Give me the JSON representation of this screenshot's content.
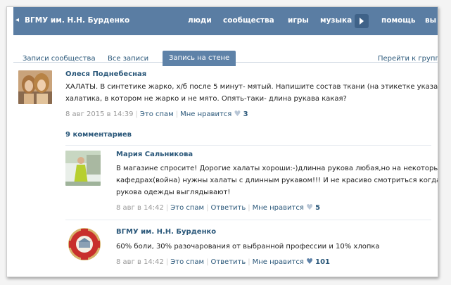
{
  "topbar": {
    "back_glyph": "◂",
    "title": "ВГМУ им. Н.Н. Бурденко",
    "nav": [
      "люди",
      "сообщества",
      "игры",
      "музыка",
      "помощь",
      "вы"
    ]
  },
  "tabs": {
    "items": [
      "Записи сообщества",
      "Все записи",
      "Запись на стене"
    ],
    "active_index": 2,
    "right_link": "Перейти к групп"
  },
  "post": {
    "author": "Олеся Поднебесная",
    "text_line1": "ХАЛАТЫ. В синтетике жарко, х/б после 5 минут- мятый. Напишите состав ткани (на этикетке указан) для",
    "text_line2": "халатика, в котором не жарко и не мято. Опять-таки- длина рукава какая?",
    "date": "8 авг 2015 в 14:39",
    "spam": "Это спам",
    "like": "Мне нравится",
    "likes": "3"
  },
  "comments_header": "9 комментариев",
  "comments": [
    {
      "author": "Мария Сальникова",
      "text_line1": "В магазине спросите! Дорогие халаты хороши:-)длинна рукова любая,но на некоторых",
      "text_line2": "кафедрах(война) нужны халаты с длинным рукавом!!! И не красиво смотриться когда",
      "text_line3": "рукова одежды выглядывают!",
      "date": "8 авг в 14:42",
      "spam": "Это спам",
      "reply": "Ответить",
      "like": "Мне нравится",
      "likes": "5"
    },
    {
      "author": "ВГМУ им. Н.Н. Бурденко",
      "text_line1": "60% боли, 30% разочарования от выбранной профессии и 10% хлопка",
      "date": "8 авг в 14:42",
      "spam": "Это спам",
      "reply": "Ответить",
      "like": "Мне нравится",
      "likes": "101"
    }
  ],
  "icons": {
    "nav_arrow": "chevron-right-icon",
    "heart": "heart-icon"
  },
  "colors": {
    "topbar": "#5a7da3",
    "link": "#2b587a",
    "tab_active": "#5e82a8"
  }
}
